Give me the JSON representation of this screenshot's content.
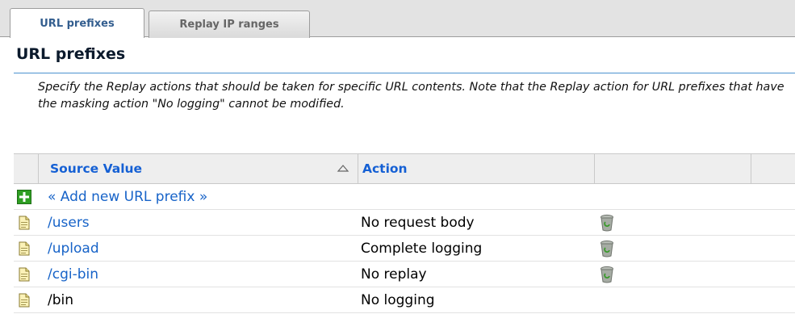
{
  "tabs": [
    {
      "label": "URL prefixes",
      "active": true
    },
    {
      "label": "Replay IP ranges",
      "active": false
    }
  ],
  "section": {
    "title": "URL prefixes",
    "description": "Specify the Replay actions that should be taken for specific URL contents. Note that the Replay action for URL prefixes that have the masking action \"No logging\" cannot be modified."
  },
  "table": {
    "columns": {
      "source_value": "Source Value",
      "action": "Action"
    },
    "add_new_label": "« Add new URL prefix »",
    "rows": [
      {
        "source": "/users",
        "action": "No request body",
        "deletable": true
      },
      {
        "source": "/upload",
        "action": "Complete logging",
        "deletable": true
      },
      {
        "source": "/cgi-bin",
        "action": "No replay",
        "deletable": true
      },
      {
        "source": "/bin",
        "action": "No logging",
        "deletable": false
      }
    ]
  },
  "icons": {
    "add": "plus-icon",
    "row": "document-icon",
    "delete": "trash-icon",
    "sort": "sort-ascending-icon"
  },
  "colors": {
    "link": "#1763c8",
    "header_text": "#1560d4",
    "heading_rule": "#4b92d0",
    "active_tab_text": "#335e8f",
    "add_icon_green": "#2e9e22"
  }
}
